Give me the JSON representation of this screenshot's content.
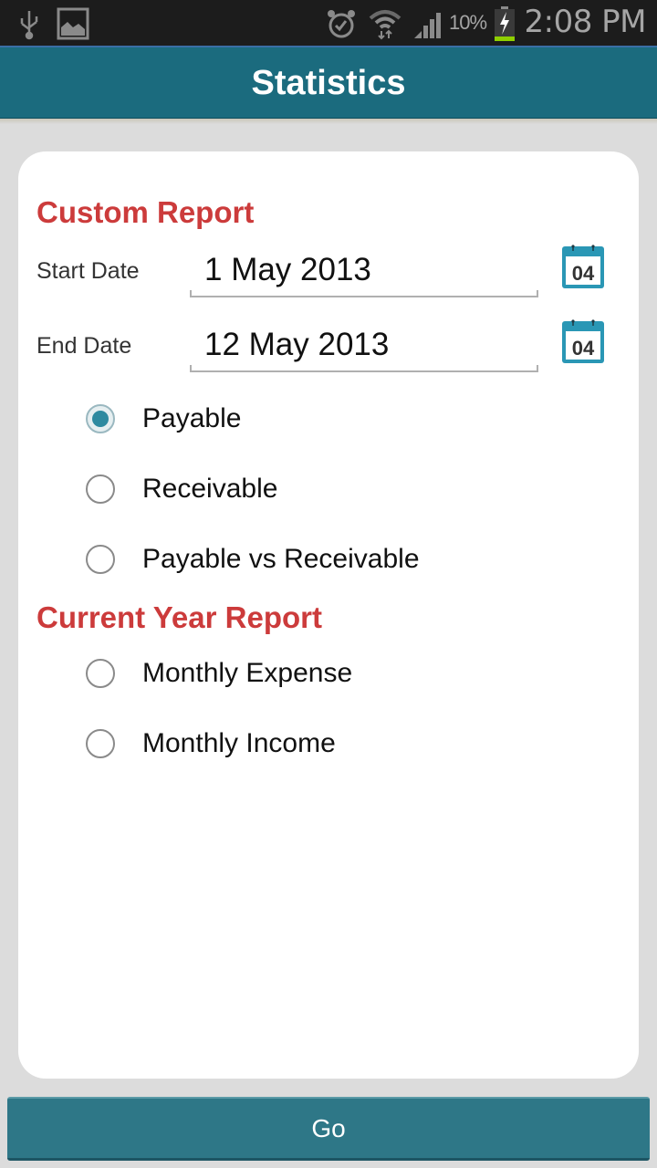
{
  "status_bar": {
    "time": "2:08 PM",
    "battery_percent": "10%",
    "icons": [
      "usb-icon",
      "gallery-icon",
      "alarm-icon",
      "wifi-icon",
      "signal-icon",
      "battery-charging-icon"
    ]
  },
  "header": {
    "title": "Statistics"
  },
  "custom_report": {
    "title": "Custom Report",
    "start_date": {
      "label": "Start Date",
      "value": "1 May 2013"
    },
    "end_date": {
      "label": "End Date",
      "value": "12 May 2013"
    },
    "calendar_icon_text": "04",
    "options": [
      {
        "label": "Payable",
        "checked": true
      },
      {
        "label": "Receivable",
        "checked": false
      },
      {
        "label": "Payable vs Receivable",
        "checked": false
      }
    ]
  },
  "current_year_report": {
    "title": "Current Year Report",
    "options": [
      {
        "label": "Monthly Expense",
        "checked": false
      },
      {
        "label": "Monthly Income",
        "checked": false
      }
    ]
  },
  "go_button": {
    "label": "Go"
  },
  "colors": {
    "accent": "#1b6b7e",
    "section_title": "#cc3b3b",
    "radio_checked": "#2e8aa0",
    "button": "#2e7787"
  }
}
